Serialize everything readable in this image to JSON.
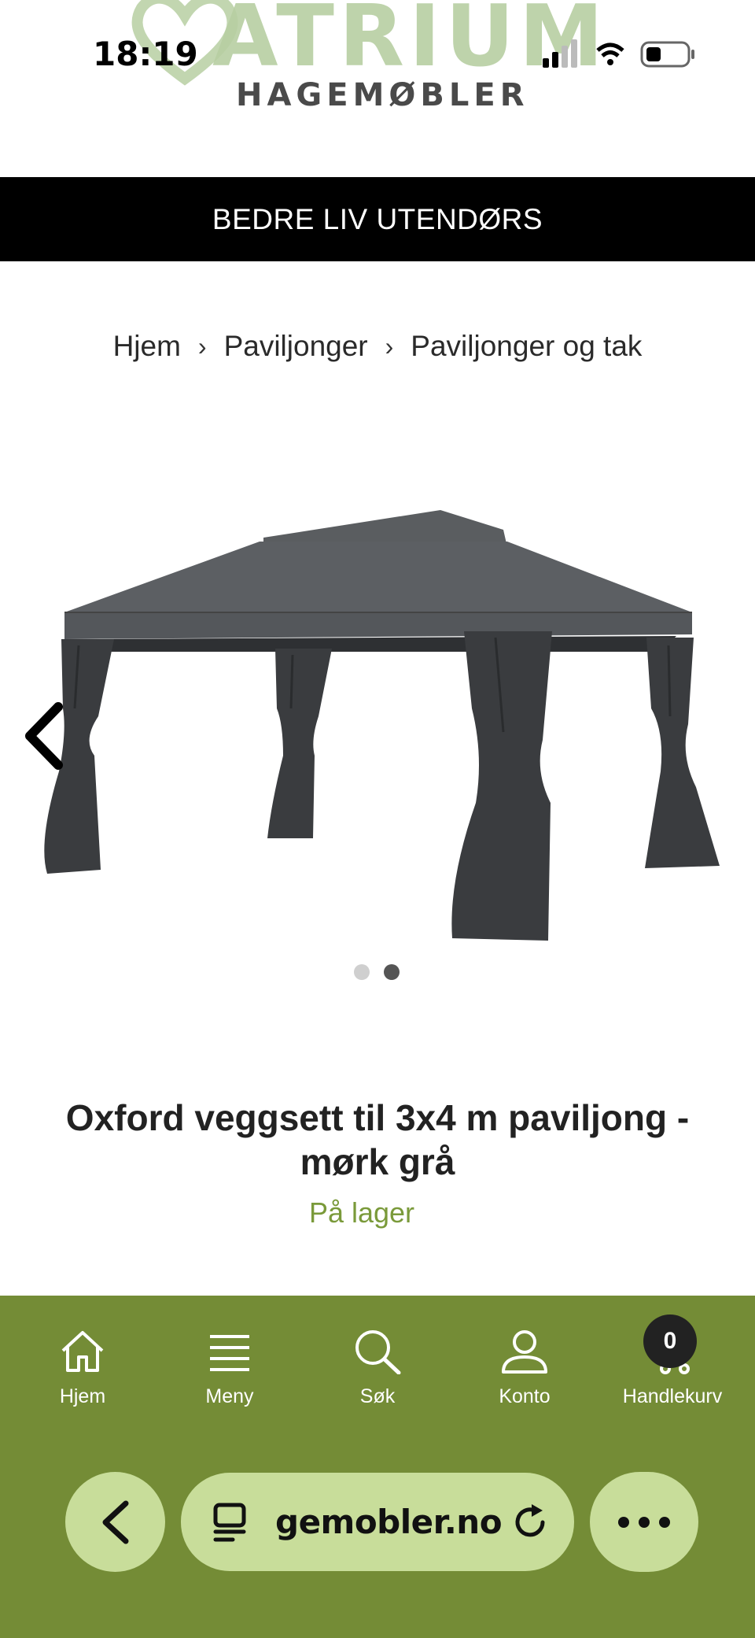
{
  "status_bar": {
    "time": "18:19"
  },
  "logo": {
    "word": "ATRIUM",
    "sub": "HAGEMØBLER"
  },
  "banner": {
    "text": "BEDRE LIV UTENDØRS"
  },
  "breadcrumb": {
    "items": [
      "Hjem",
      "Paviljonger",
      "Paviljonger og tak"
    ],
    "separator": "›"
  },
  "gallery": {
    "slide_count": 2,
    "active_slide": 2
  },
  "product": {
    "title": "Oxford veggsett til 3x4 m paviljong - mørk grå",
    "stock": "På lager"
  },
  "bottom_nav": {
    "items": [
      {
        "label": "Hjem",
        "icon": "home-icon"
      },
      {
        "label": "Meny",
        "icon": "menu-icon"
      },
      {
        "label": "Søk",
        "icon": "search-icon"
      },
      {
        "label": "Konto",
        "icon": "user-icon"
      },
      {
        "label": "Handlekurv",
        "icon": "cart-icon"
      }
    ],
    "cart_count": "0"
  },
  "browser": {
    "url": "gemobler.no"
  },
  "colors": {
    "nav_green": "#748c36",
    "pill_green": "#c8dd9a",
    "stock_green": "#7a9a3a",
    "banner_bg": "#000000"
  }
}
